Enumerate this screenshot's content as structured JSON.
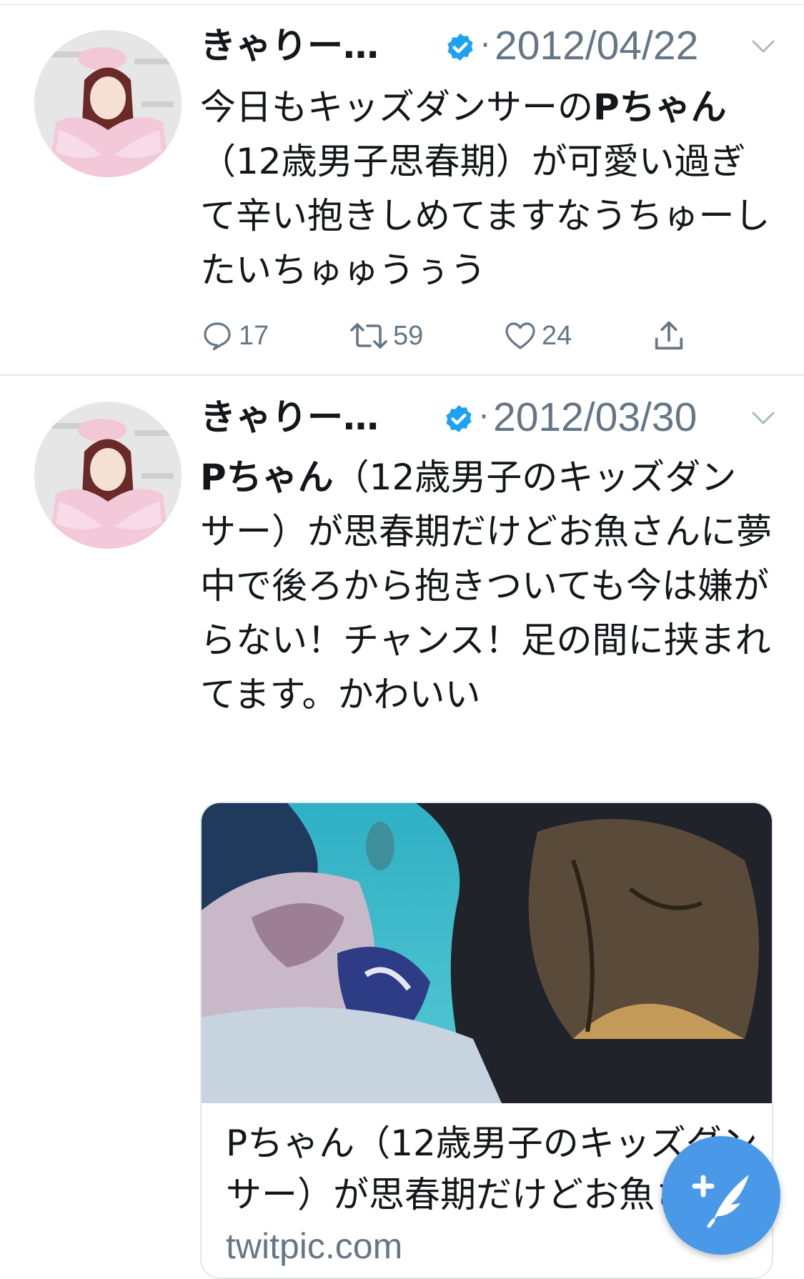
{
  "colors": {
    "accent": "#4a99e9",
    "verified": "#1da1f2",
    "secondary_text": "#657786",
    "divider": "#e1e8ed"
  },
  "tweets": [
    {
      "user_name": "きゃりー…",
      "separator": "·",
      "date": "2012/04/22",
      "text_parts": [
        {
          "text": "今日もキッズダンサーの"
        },
        {
          "text": "Pちゃん",
          "bold": true
        },
        {
          "text": "（12歳男子思春期）が可愛い過ぎて辛い抱きしめてますなうちゅーしたいちゅゅうぅう"
        }
      ],
      "actions": {
        "replies": "17",
        "retweets": "59",
        "likes": "24"
      },
      "icons": [
        "reply-icon",
        "retweet-icon",
        "like-icon",
        "share-icon"
      ]
    },
    {
      "user_name": "きゃりー…",
      "separator": "·",
      "date": "2012/03/30",
      "text_parts": [
        {
          "text": "Pちゃん",
          "bold": true
        },
        {
          "text": "（12歳男子のキッズダンサー）が思春期だけどお魚さんに夢中で後ろから抱きついても今は嫌がらない！チャンス！足の間に挟まれてます。かわいい"
        }
      ],
      "card": {
        "title": "Pちゃん（12歳男子のキッズダンサー）が思春期だけどお魚さん",
        "domain": "twitpic.com"
      }
    }
  ],
  "compose_button": {
    "icon": "compose-tweet-icon"
  }
}
